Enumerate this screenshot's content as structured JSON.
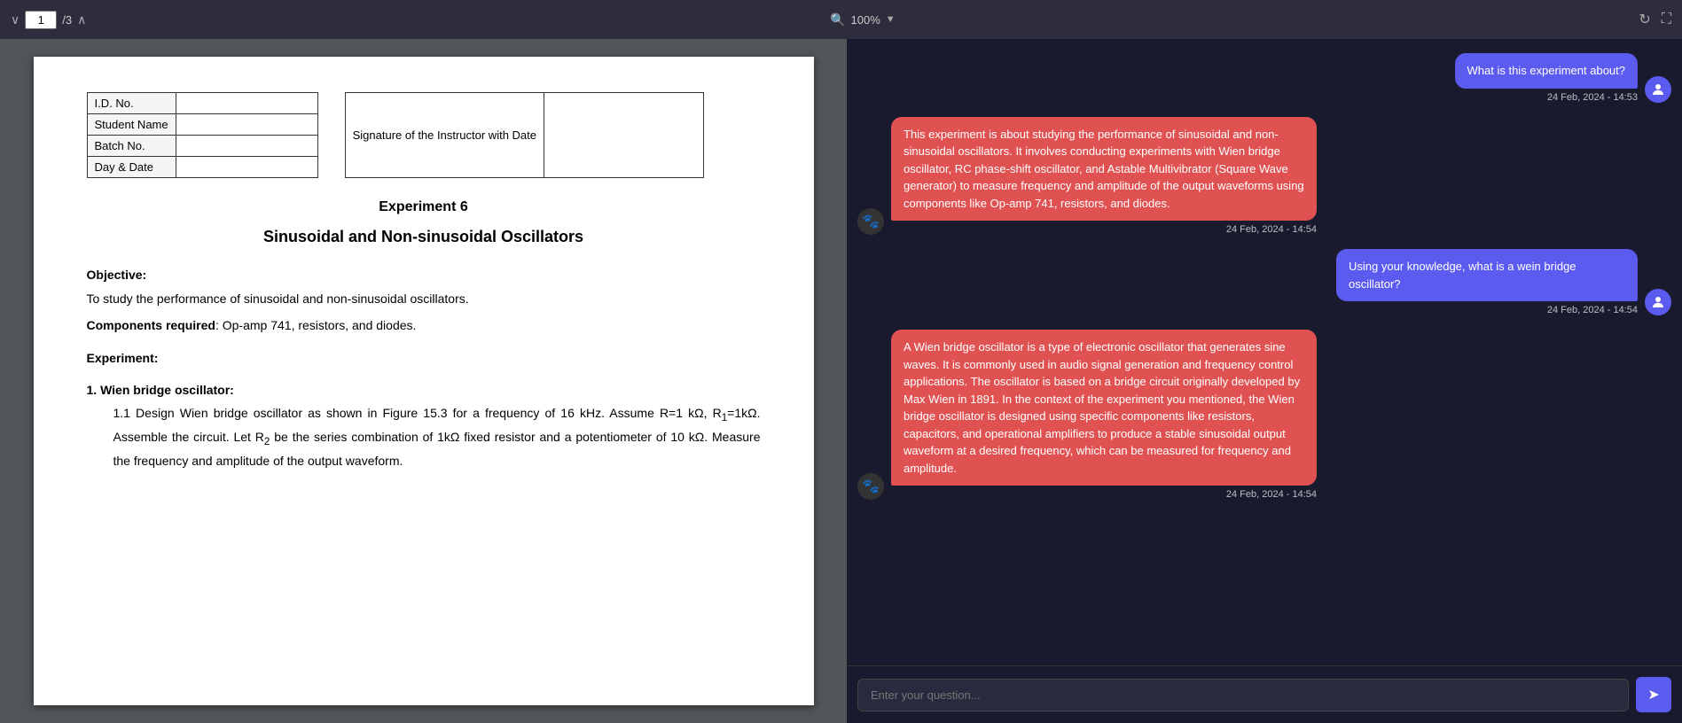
{
  "toolbar": {
    "page_current": "1",
    "page_separator": "/",
    "page_total": "3",
    "zoom_label": "100%",
    "chevron_down": "∨",
    "chevron_up": "∧",
    "search_icon": "🔍",
    "refresh_icon": "↻",
    "fullscreen_icon": "⛶"
  },
  "pdf": {
    "form": {
      "id_label": "I.D. No.",
      "student_label": "Student Name",
      "batch_label": "Batch No.",
      "day_label": "Day & Date",
      "signature_label": "Signature of the Instructor with Date"
    },
    "experiment_number": "Experiment 6",
    "experiment_title": "Sinusoidal and Non-sinusoidal Oscillators",
    "objective_label": "Objective:",
    "objective_text": "To study the performance of sinusoidal and non-sinusoidal oscillators.",
    "components_label": "Components required",
    "components_text": ": Op-amp 741, resistors, and diodes.",
    "experiment_label": "Experiment:",
    "section1_label": "1. Wien bridge oscillator:",
    "item1_1": "1.1 Design Wien bridge oscillator as shown in Figure 15.3 for a frequency of 16 kHz. Assume R=1 kΩ, R₁=1kΩ. Assemble the circuit. Let R₂ be the series combination of 1kΩ fixed resistor and a potentiometer of 10 kΩ. Measure the frequency and amplitude of the output waveform."
  },
  "chat": {
    "messages": [
      {
        "type": "user",
        "text": "What is this experiment about?",
        "time": "24 Feb, 2024 - 14:53"
      },
      {
        "type": "ai",
        "text": "This experiment is about studying the performance of sinusoidal and non-sinusoidal oscillators. It involves conducting experiments with Wien bridge oscillator, RC phase-shift oscillator, and Astable Multivibrator (Square Wave generator) to measure frequency and amplitude of the output waveforms using components like Op-amp 741, resistors, and diodes.",
        "time": "24 Feb, 2024 - 14:54"
      },
      {
        "type": "user",
        "text": "Using your knowledge, what is a wein bridge oscillator?",
        "time": "24 Feb, 2024 - 14:54"
      },
      {
        "type": "ai",
        "text": "A Wien bridge oscillator is a type of electronic oscillator that generates sine waves. It is commonly used in audio signal generation and frequency control applications. The oscillator is based on a bridge circuit originally developed by Max Wien in 1891. In the context of the experiment you mentioned, the Wien bridge oscillator is designed using specific components like resistors, capacitors, and operational amplifiers to produce a stable sinusoidal output waveform at a desired frequency, which can be measured for frequency and amplitude.",
        "time": "24 Feb, 2024 - 14:54"
      }
    ],
    "input_placeholder": "Enter your question...",
    "send_icon": "➤"
  }
}
